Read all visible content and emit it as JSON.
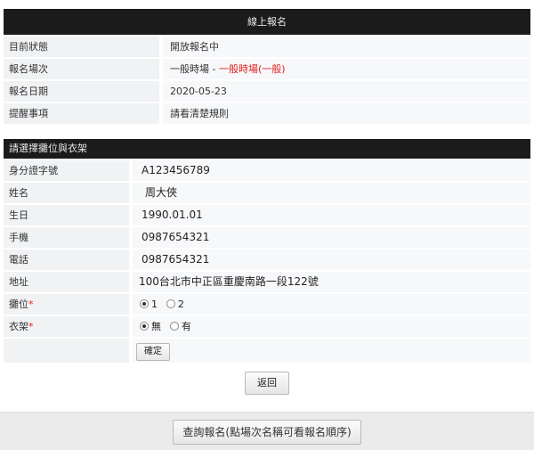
{
  "section1": {
    "title": "線上報名",
    "rows": [
      {
        "label": "目前狀態",
        "value": "開放報名中"
      },
      {
        "label": "報名場次",
        "value_prefix": "一般時場 - ",
        "value_red": "一般時場(一般)"
      },
      {
        "label": "報名日期",
        "value": "2020-05-23"
      },
      {
        "label": "提醒事項",
        "value": "請看清楚規則"
      }
    ]
  },
  "section2": {
    "title": "請選擇攤位與衣架",
    "fields": {
      "id_label": "身分證字號",
      "id_value": "A123456789",
      "name_label": "姓名",
      "name_value": "周大俠",
      "birth_label": "生日",
      "birth_value": "1990.01.01",
      "mobile_label": "手機",
      "mobile_value": "0987654321",
      "phone_label": "電話",
      "phone_value": "0987654321",
      "address_label": "地址",
      "address_value": "100台北市中正區重慶南路一段122號",
      "booth_label": "攤位",
      "booth_required": "*",
      "booth_options": [
        "1",
        "2"
      ],
      "rack_label": "衣架",
      "rack_required": "*",
      "rack_options": [
        "無",
        "有"
      ]
    },
    "confirm_label": "確定"
  },
  "back_label": "返回",
  "query_label": "查詢報名(點場次名稱可看報名順序)"
}
